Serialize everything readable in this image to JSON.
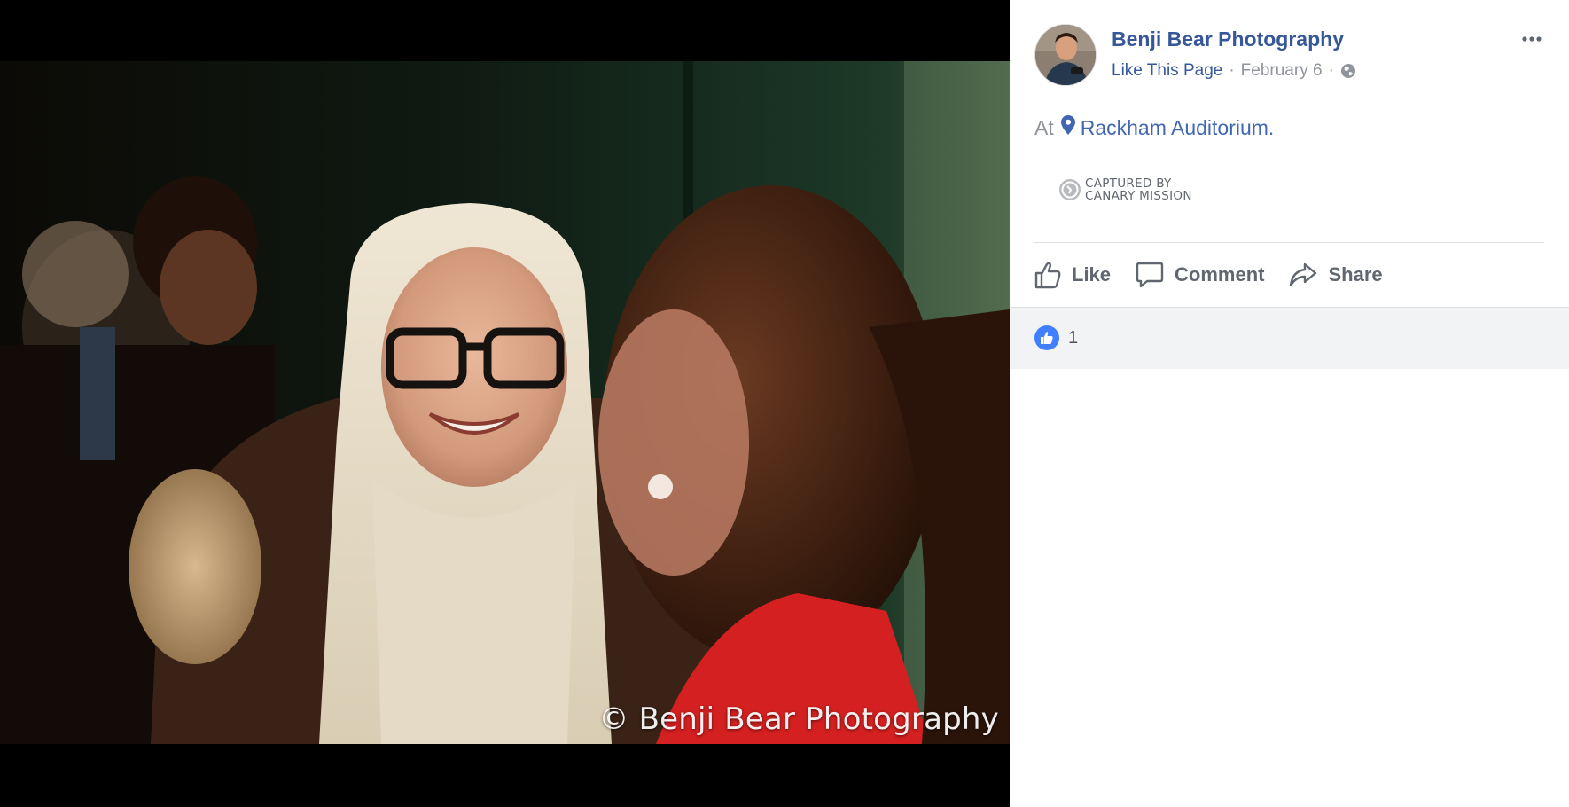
{
  "photo": {
    "watermark": "© Benji Bear Photography"
  },
  "post": {
    "page_name": "Benji Bear Photography",
    "like_page_label": "Like This Page",
    "date": "February 6",
    "separator": "·",
    "location_prefix": "At",
    "location_name": "Rackham Auditorium.",
    "captured_by_line1": "CAPTURED BY",
    "captured_by_line2": "CANARY MISSION"
  },
  "actions": {
    "like_label": "Like",
    "comment_label": "Comment",
    "share_label": "Share"
  },
  "reactions": {
    "count": "1"
  },
  "colors": {
    "link_blue": "#365899",
    "action_gray": "#606770",
    "like_badge_blue": "#4080ff",
    "reaction_bar_bg": "#f2f3f5"
  },
  "icons": {
    "more": "more-horizontal-icon",
    "privacy": "globe-icon",
    "location": "map-pin-icon",
    "like": "thumbs-up-icon",
    "comment": "speech-bubble-icon",
    "share": "share-arrow-icon"
  }
}
